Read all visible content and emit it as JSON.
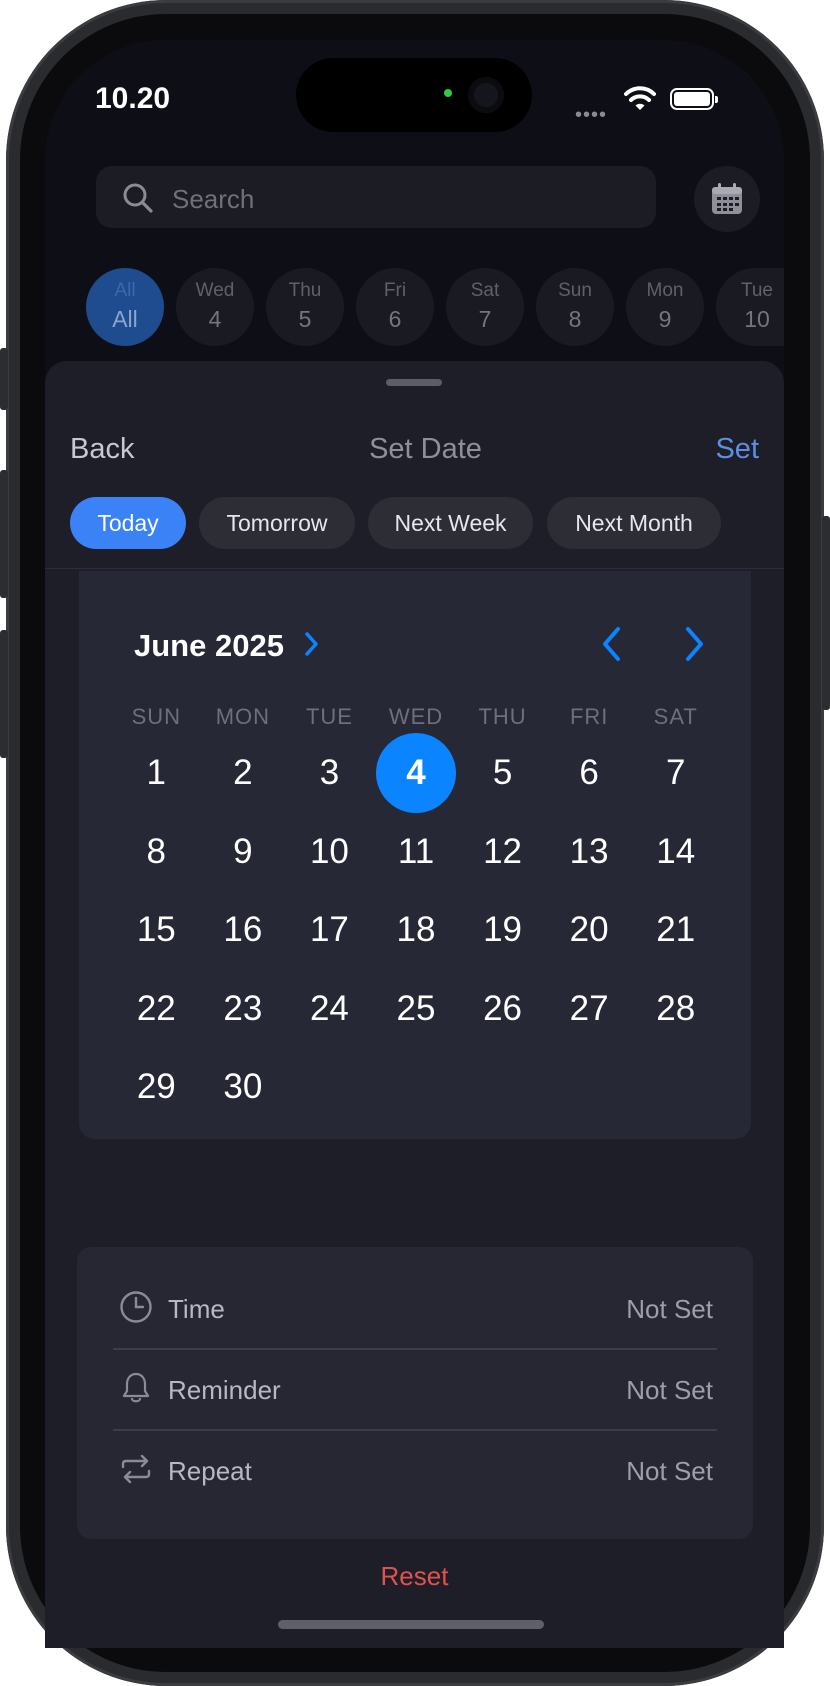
{
  "status_bar": {
    "time": "10.20"
  },
  "search": {
    "placeholder": "Search"
  },
  "day_chips": [
    {
      "day": "All",
      "num": "All",
      "active": true
    },
    {
      "day": "Wed",
      "num": "4"
    },
    {
      "day": "Thu",
      "num": "5"
    },
    {
      "day": "Fri",
      "num": "6"
    },
    {
      "day": "Sat",
      "num": "7"
    },
    {
      "day": "Sun",
      "num": "8"
    },
    {
      "day": "Mon",
      "num": "9"
    },
    {
      "day": "Tue",
      "num": "10"
    }
  ],
  "sheet": {
    "back_label": "Back",
    "title": "Set Date",
    "set_label": "Set",
    "quick_options": [
      "Today",
      "Tomorrow",
      "Next Week",
      "Next Month"
    ],
    "active_quick_option": "Today"
  },
  "calendar": {
    "month_label": "June 2025",
    "weekdays": [
      "SUN",
      "MON",
      "TUE",
      "WED",
      "THU",
      "FRI",
      "SAT"
    ],
    "weeks": [
      [
        "1",
        "2",
        "3",
        "4",
        "5",
        "6",
        "7"
      ],
      [
        "8",
        "9",
        "10",
        "11",
        "12",
        "13",
        "14"
      ],
      [
        "15",
        "16",
        "17",
        "18",
        "19",
        "20",
        "21"
      ],
      [
        "22",
        "23",
        "24",
        "25",
        "26",
        "27",
        "28"
      ],
      [
        "29",
        "30"
      ]
    ],
    "selected_day": "4",
    "accent_color": "#0a84ff"
  },
  "settings": {
    "time": {
      "label": "Time",
      "value": "Not Set",
      "icon": "clock-icon"
    },
    "reminder": {
      "label": "Reminder",
      "value": "Not Set",
      "icon": "bell-icon"
    },
    "repeat": {
      "label": "Repeat",
      "value": "Not Set",
      "icon": "repeat-icon"
    }
  },
  "reset_label": "Reset"
}
